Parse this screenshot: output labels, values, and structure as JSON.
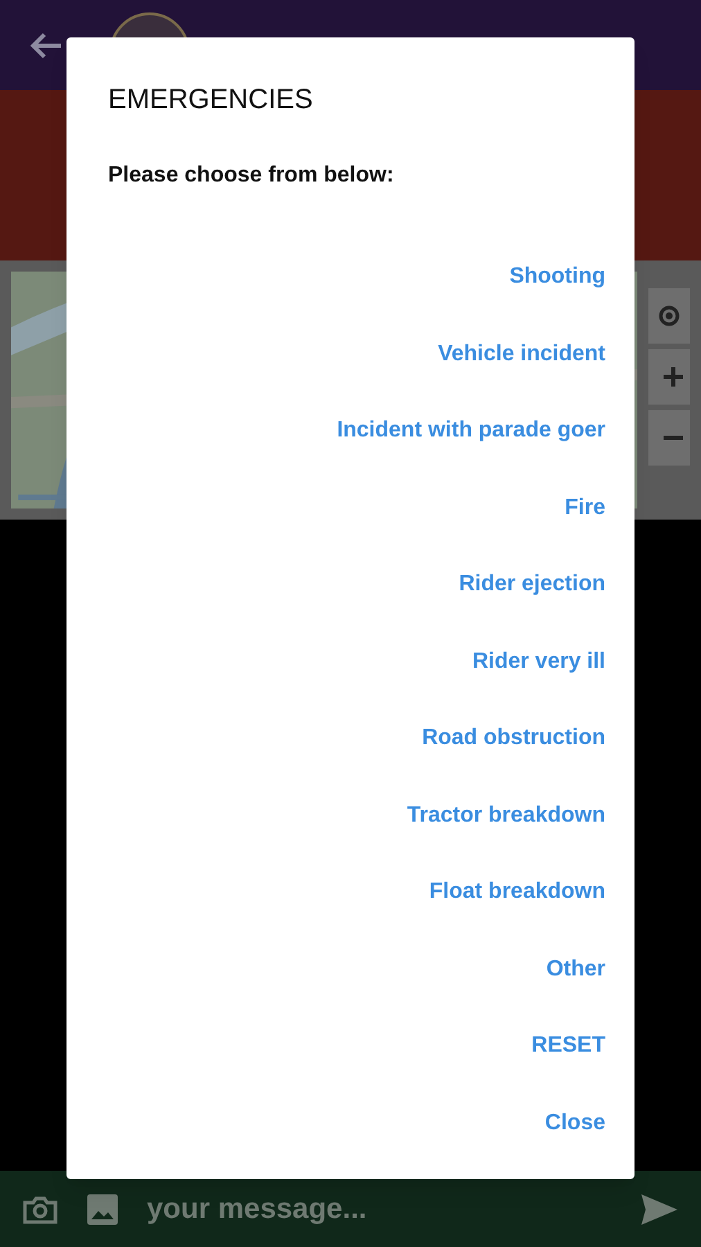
{
  "dialog": {
    "title": "EMERGENCIES",
    "prompt": "Please choose from below:",
    "options": [
      {
        "label": "Shooting"
      },
      {
        "label": "Vehicle incident"
      },
      {
        "label": "Incident with parade goer"
      },
      {
        "label": "Fire"
      },
      {
        "label": "Rider ejection"
      },
      {
        "label": "Rider very ill"
      },
      {
        "label": "Road obstruction"
      },
      {
        "label": "Tractor breakdown"
      },
      {
        "label": "Float breakdown"
      },
      {
        "label": "Other"
      }
    ],
    "actions": [
      {
        "label": "RESET"
      },
      {
        "label": "Close"
      }
    ]
  },
  "composer": {
    "placeholder": "your message..."
  }
}
